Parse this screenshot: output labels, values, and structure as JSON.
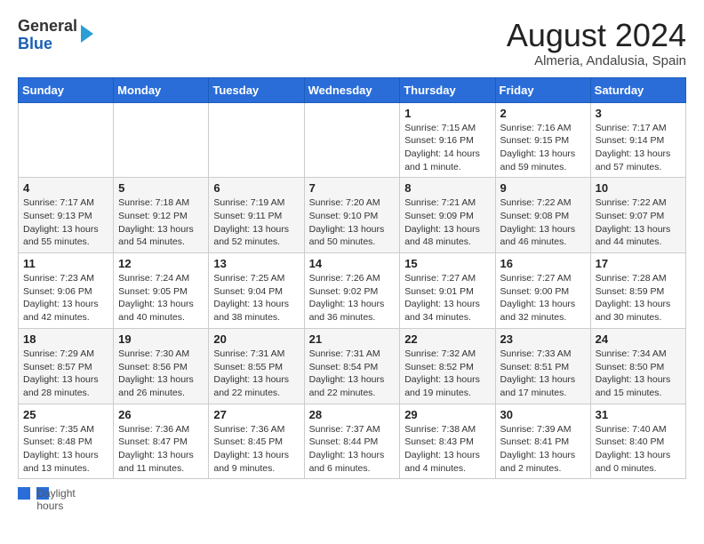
{
  "header": {
    "logo_line1": "General",
    "logo_line2": "Blue",
    "month_year": "August 2024",
    "location": "Almeria, Andalusia, Spain"
  },
  "days_of_week": [
    "Sunday",
    "Monday",
    "Tuesday",
    "Wednesday",
    "Thursday",
    "Friday",
    "Saturday"
  ],
  "weeks": [
    [
      {
        "day": "",
        "info": ""
      },
      {
        "day": "",
        "info": ""
      },
      {
        "day": "",
        "info": ""
      },
      {
        "day": "",
        "info": ""
      },
      {
        "day": "1",
        "info": "Sunrise: 7:15 AM\nSunset: 9:16 PM\nDaylight: 14 hours\nand 1 minute."
      },
      {
        "day": "2",
        "info": "Sunrise: 7:16 AM\nSunset: 9:15 PM\nDaylight: 13 hours\nand 59 minutes."
      },
      {
        "day": "3",
        "info": "Sunrise: 7:17 AM\nSunset: 9:14 PM\nDaylight: 13 hours\nand 57 minutes."
      }
    ],
    [
      {
        "day": "4",
        "info": "Sunrise: 7:17 AM\nSunset: 9:13 PM\nDaylight: 13 hours\nand 55 minutes."
      },
      {
        "day": "5",
        "info": "Sunrise: 7:18 AM\nSunset: 9:12 PM\nDaylight: 13 hours\nand 54 minutes."
      },
      {
        "day": "6",
        "info": "Sunrise: 7:19 AM\nSunset: 9:11 PM\nDaylight: 13 hours\nand 52 minutes."
      },
      {
        "day": "7",
        "info": "Sunrise: 7:20 AM\nSunset: 9:10 PM\nDaylight: 13 hours\nand 50 minutes."
      },
      {
        "day": "8",
        "info": "Sunrise: 7:21 AM\nSunset: 9:09 PM\nDaylight: 13 hours\nand 48 minutes."
      },
      {
        "day": "9",
        "info": "Sunrise: 7:22 AM\nSunset: 9:08 PM\nDaylight: 13 hours\nand 46 minutes."
      },
      {
        "day": "10",
        "info": "Sunrise: 7:22 AM\nSunset: 9:07 PM\nDaylight: 13 hours\nand 44 minutes."
      }
    ],
    [
      {
        "day": "11",
        "info": "Sunrise: 7:23 AM\nSunset: 9:06 PM\nDaylight: 13 hours\nand 42 minutes."
      },
      {
        "day": "12",
        "info": "Sunrise: 7:24 AM\nSunset: 9:05 PM\nDaylight: 13 hours\nand 40 minutes."
      },
      {
        "day": "13",
        "info": "Sunrise: 7:25 AM\nSunset: 9:04 PM\nDaylight: 13 hours\nand 38 minutes."
      },
      {
        "day": "14",
        "info": "Sunrise: 7:26 AM\nSunset: 9:02 PM\nDaylight: 13 hours\nand 36 minutes."
      },
      {
        "day": "15",
        "info": "Sunrise: 7:27 AM\nSunset: 9:01 PM\nDaylight: 13 hours\nand 34 minutes."
      },
      {
        "day": "16",
        "info": "Sunrise: 7:27 AM\nSunset: 9:00 PM\nDaylight: 13 hours\nand 32 minutes."
      },
      {
        "day": "17",
        "info": "Sunrise: 7:28 AM\nSunset: 8:59 PM\nDaylight: 13 hours\nand 30 minutes."
      }
    ],
    [
      {
        "day": "18",
        "info": "Sunrise: 7:29 AM\nSunset: 8:57 PM\nDaylight: 13 hours\nand 28 minutes."
      },
      {
        "day": "19",
        "info": "Sunrise: 7:30 AM\nSunset: 8:56 PM\nDaylight: 13 hours\nand 26 minutes."
      },
      {
        "day": "20",
        "info": "Sunrise: 7:31 AM\nSunset: 8:55 PM\nDaylight: 13 hours\nand 22 minutes."
      },
      {
        "day": "21",
        "info": "Sunrise: 7:31 AM\nSunset: 8:54 PM\nDaylight: 13 hours\nand 22 minutes."
      },
      {
        "day": "22",
        "info": "Sunrise: 7:32 AM\nSunset: 8:52 PM\nDaylight: 13 hours\nand 19 minutes."
      },
      {
        "day": "23",
        "info": "Sunrise: 7:33 AM\nSunset: 8:51 PM\nDaylight: 13 hours\nand 17 minutes."
      },
      {
        "day": "24",
        "info": "Sunrise: 7:34 AM\nSunset: 8:50 PM\nDaylight: 13 hours\nand 15 minutes."
      }
    ],
    [
      {
        "day": "25",
        "info": "Sunrise: 7:35 AM\nSunset: 8:48 PM\nDaylight: 13 hours\nand 13 minutes."
      },
      {
        "day": "26",
        "info": "Sunrise: 7:36 AM\nSunset: 8:47 PM\nDaylight: 13 hours\nand 11 minutes."
      },
      {
        "day": "27",
        "info": "Sunrise: 7:36 AM\nSunset: 8:45 PM\nDaylight: 13 hours\nand 9 minutes."
      },
      {
        "day": "28",
        "info": "Sunrise: 7:37 AM\nSunset: 8:44 PM\nDaylight: 13 hours\nand 6 minutes."
      },
      {
        "day": "29",
        "info": "Sunrise: 7:38 AM\nSunset: 8:43 PM\nDaylight: 13 hours\nand 4 minutes."
      },
      {
        "day": "30",
        "info": "Sunrise: 7:39 AM\nSunset: 8:41 PM\nDaylight: 13 hours\nand 2 minutes."
      },
      {
        "day": "31",
        "info": "Sunrise: 7:40 AM\nSunset: 8:40 PM\nDaylight: 13 hours\nand 0 minutes."
      }
    ]
  ],
  "footer": {
    "label": "Daylight hours"
  }
}
